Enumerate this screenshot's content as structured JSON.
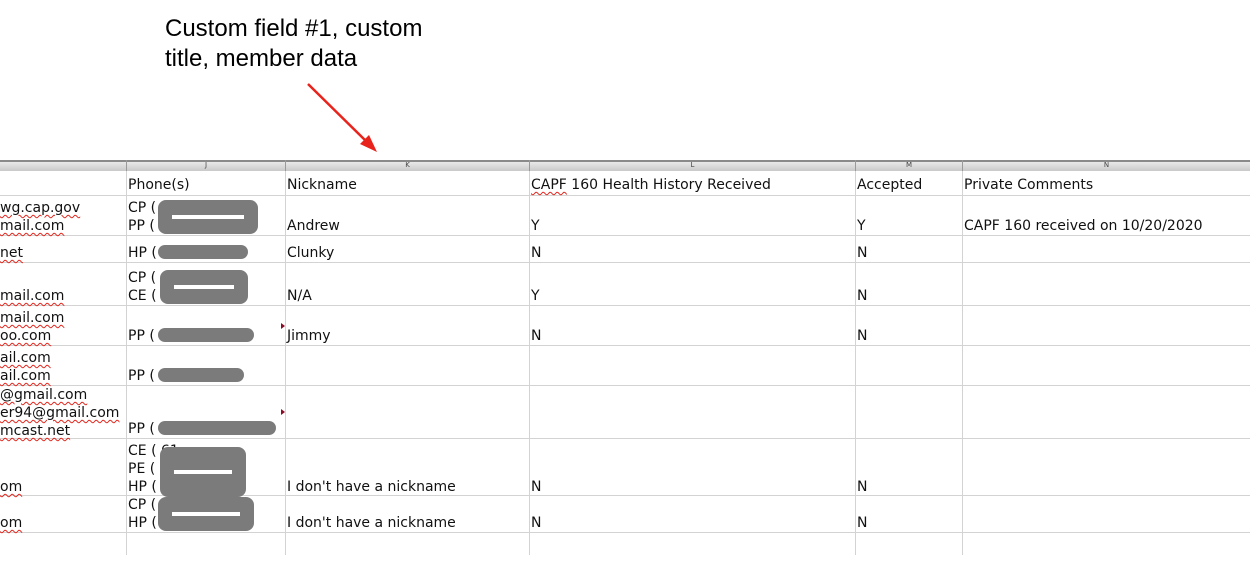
{
  "annotation": {
    "text": "Custom field #1, custom\ntitle, member data"
  },
  "columns": [
    {
      "letter": "J",
      "header": "Phone(s)"
    },
    {
      "letter": "K",
      "header": "Nickname"
    },
    {
      "letter": "L",
      "header": "CAPF 160 Health History Received"
    },
    {
      "letter": "M",
      "header": "Accepted"
    },
    {
      "letter": "N",
      "header": "Private Comments"
    }
  ],
  "rows": [
    {
      "email": "wg.cap.gov\nmail.com",
      "phone": "CP (          3\nPP (          3",
      "nickname": "Andrew",
      "capf160": "Y",
      "accepted": "Y",
      "comments": "CAPF 160 received on 10/20/2020"
    },
    {
      "email": "net",
      "phone": "HP (            7",
      "nickname": "Clunky",
      "capf160": "N",
      "accepted": "N",
      "comments": ""
    },
    {
      "email": "\nmail.com",
      "phone": "CP (          4\nCE (          1",
      "nickname": "N/A",
      "capf160": "Y",
      "accepted": "N",
      "comments": ""
    },
    {
      "email": "mail.com\noo.com",
      "phone": "PP (          3PE",
      "nickname": "Jimmy",
      "capf160": "N",
      "accepted": "N",
      "comments": ""
    },
    {
      "email": "ail.com\nail.com",
      "phone": "PP (          16",
      "nickname": "",
      "capf160": "",
      "accepted": "",
      "comments": ""
    },
    {
      "email": "@gmail.com\ner94@gmail.com\nmcast.net",
      "phone": "PP (            P",
      "nickname": "",
      "capf160": "",
      "accepted": "",
      "comments": ""
    },
    {
      "email": "\n\nom",
      "phone": "CE (          61\nPE (          28\nHP (          28",
      "nickname": "I don't have a nickname",
      "capf160": "N",
      "accepted": "N",
      "comments": ""
    },
    {
      "email": "\nom",
      "phone": "CP (          0\nHP (          4",
      "nickname": "I don't have a nickname",
      "capf160": "N",
      "accepted": "N",
      "comments": ""
    }
  ],
  "colors": {
    "arrow": "#e8231b",
    "redaction": "#7b7b7b",
    "grid": "#d3d3d3"
  }
}
